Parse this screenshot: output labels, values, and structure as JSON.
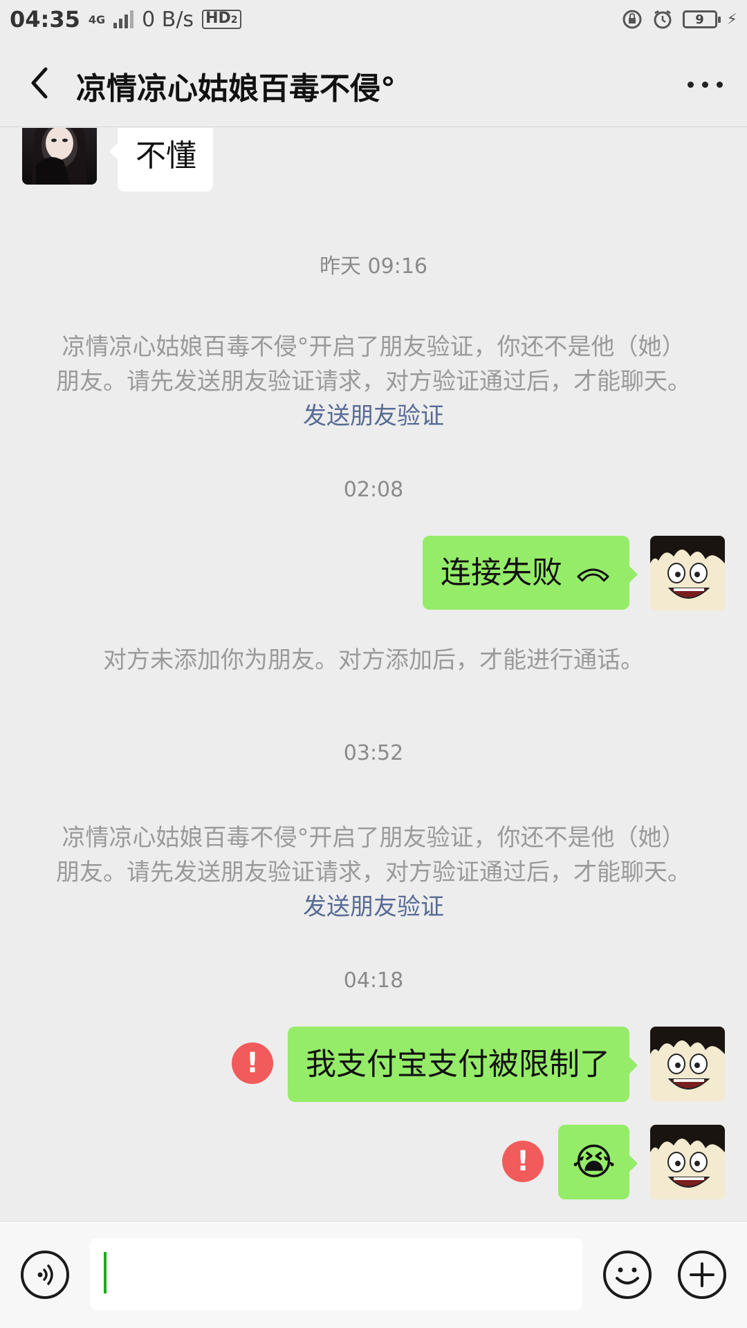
{
  "status_bar": {
    "time": "04:35",
    "network": "4G",
    "speed": "0 B/s",
    "hd": "HD",
    "hd_sub": "2",
    "battery": "9"
  },
  "header": {
    "title": "凉情凉心姑娘百毒不侵°"
  },
  "messages": {
    "m1_text": "不懂",
    "t1": "昨天 09:16",
    "sys1_text": "凉情凉心姑娘百毒不侵°开启了朋友验证，你还不是他（她）朋友。请先发送朋友验证请求，对方验证通过后，才能聊天。",
    "sys1_link": "发送朋友验证",
    "t2": "02:08",
    "m2_text": "连接失败",
    "sys2_text": "对方未添加你为朋友。对方添加后，才能进行通话。",
    "t3": "03:52",
    "sys3_text": "凉情凉心姑娘百毒不侵°开启了朋友验证，你还不是他（她）朋友。请先发送朋友验证请求，对方验证通过后，才能聊天。",
    "sys3_link": "发送朋友验证",
    "t4": "04:18",
    "m3_text": "我支付宝支付被限制了",
    "m4_emoji": "😭",
    "error_mark": "!"
  },
  "icons": {
    "back": "chevron-left-icon",
    "more": "more-dots-icon",
    "hangup": "phone-hangup-icon",
    "voice": "voice-icon",
    "emoji": "emoji-icon",
    "plus": "plus-icon"
  },
  "colors": {
    "accent_green": "#95ec69",
    "link": "#576b95",
    "error": "#f25b5b",
    "cursor": "#1aad19"
  }
}
